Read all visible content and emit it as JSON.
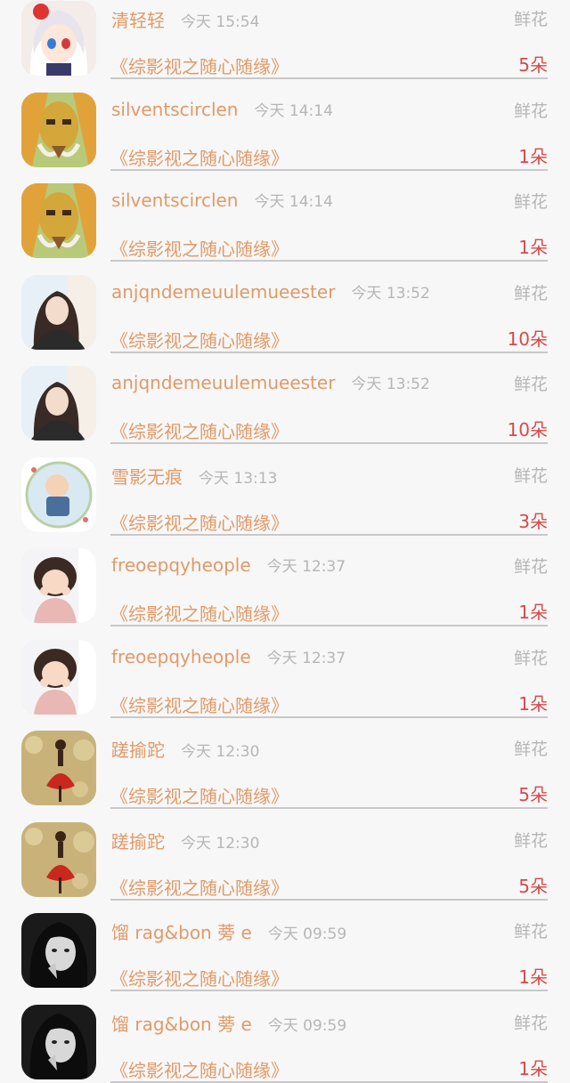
{
  "items": [
    {
      "avatar": "anime-girl",
      "name": "清轻轻",
      "time": "今天 15:54",
      "kind": "鲜花",
      "book": "《综影视之随心随缘》",
      "count": "5朵"
    },
    {
      "avatar": "golden-mask",
      "name": "silventscirclen",
      "time": "今天 14:14",
      "kind": "鲜花",
      "book": "《综影视之随心随缘》",
      "count": "1朵"
    },
    {
      "avatar": "golden-mask",
      "name": "silventscirclen",
      "time": "今天 14:14",
      "kind": "鲜花",
      "book": "《综影视之随心随缘》",
      "count": "1朵"
    },
    {
      "avatar": "woman-portrait",
      "name": "anjqndemeuulemueester",
      "time": "今天 13:52",
      "kind": "鲜花",
      "book": "《综影视之随心随缘》",
      "count": "10朵"
    },
    {
      "avatar": "woman-portrait",
      "name": "anjqndemeuulemueester",
      "time": "今天 13:52",
      "kind": "鲜花",
      "book": "《综影视之随心随缘》",
      "count": "10朵"
    },
    {
      "avatar": "baby-circle",
      "name": "雪影无痕",
      "time": "今天 13:13",
      "kind": "鲜花",
      "book": "《综影视之随心随缘》",
      "count": "3朵"
    },
    {
      "avatar": "child-girl",
      "name": "freoepqyheople",
      "time": "今天 12:37",
      "kind": "鲜花",
      "book": "《综影视之随心随缘》",
      "count": "1朵"
    },
    {
      "avatar": "child-girl",
      "name": "freoepqyheople",
      "time": "今天 12:37",
      "kind": "鲜花",
      "book": "《综影视之随心随缘》",
      "count": "1朵"
    },
    {
      "avatar": "red-dress-figure",
      "name": "蹉揄跎",
      "time": "今天 12:30",
      "kind": "鲜花",
      "book": "《综影视之随心随缘》",
      "count": "5朵"
    },
    {
      "avatar": "red-dress-figure",
      "name": "蹉揄跎",
      "time": "今天 12:30",
      "kind": "鲜花",
      "book": "《综影视之随心随缘》",
      "count": "5朵"
    },
    {
      "avatar": "bw-woman",
      "name": "馏 rag&bon 蒡 e",
      "time": "今天 09:59",
      "kind": "鲜花",
      "book": "《综影视之随心随缘》",
      "count": "1朵"
    },
    {
      "avatar": "bw-woman",
      "name": "馏 rag&bon 蒡 e",
      "time": "今天 09:59",
      "kind": "鲜花",
      "book": "《综影视之随心随缘》",
      "count": "1朵"
    }
  ]
}
